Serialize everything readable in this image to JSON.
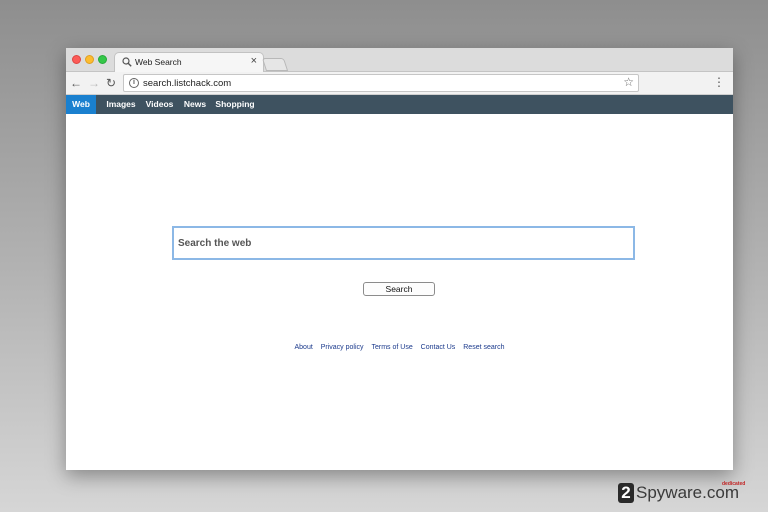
{
  "browser": {
    "tab": {
      "title": "Web Search",
      "close_glyph": "×"
    },
    "url": "search.listchack.com",
    "icons": {
      "back": "←",
      "forward": "→",
      "reload": "↻",
      "info": "i",
      "star": "☆",
      "menu": "⋮"
    }
  },
  "nav": {
    "items": [
      {
        "label": "Web",
        "active": true
      },
      {
        "label": "Images",
        "active": false
      },
      {
        "label": "Videos",
        "active": false
      },
      {
        "label": "News",
        "active": false
      },
      {
        "label": "Shopping",
        "active": false
      }
    ]
  },
  "search": {
    "placeholder": "Search the web",
    "value": "",
    "button_label": "Search"
  },
  "footer": {
    "links": [
      "About",
      "Privacy policy",
      "Terms of Use",
      "Contact Us",
      "Reset search"
    ]
  },
  "watermark": {
    "logo": "2",
    "text": "Spyware.com",
    "sub": "dedicated"
  },
  "colors": {
    "nav_bg": "#3e5260",
    "nav_active": "#1a80cf",
    "search_border": "#8cb8e6",
    "link": "#1b3a8c"
  }
}
